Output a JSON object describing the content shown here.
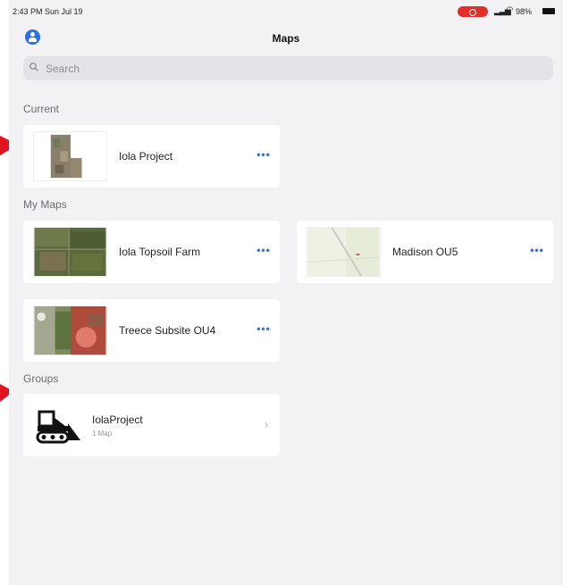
{
  "status_bar": {
    "time": "2:43 PM  Sun Jul 19",
    "battery": "98%"
  },
  "nav": {
    "title": "Maps",
    "profile_icon": "person-circle-icon"
  },
  "search": {
    "placeholder": "Search"
  },
  "sections": {
    "current": "Current",
    "my_maps": "My Maps",
    "groups": "Groups"
  },
  "current_map": {
    "name": "Iola Project",
    "more": "•••"
  },
  "my_maps": [
    {
      "name": "Iola Topsoil Farm",
      "more": "•••"
    },
    {
      "name": "Madison OU5",
      "more": "•••"
    },
    {
      "name": "Treece Subsite OU4",
      "more": "•••"
    }
  ],
  "groups": [
    {
      "name": "IolaProject",
      "subtitle": "1 Map",
      "icon": "bulldozer-icon"
    }
  ],
  "colors": {
    "accent": "#2f6fe0",
    "background": "#f2f2f5",
    "annotation_arrow": "#e0141e",
    "record_indicator": "#e0302a"
  }
}
